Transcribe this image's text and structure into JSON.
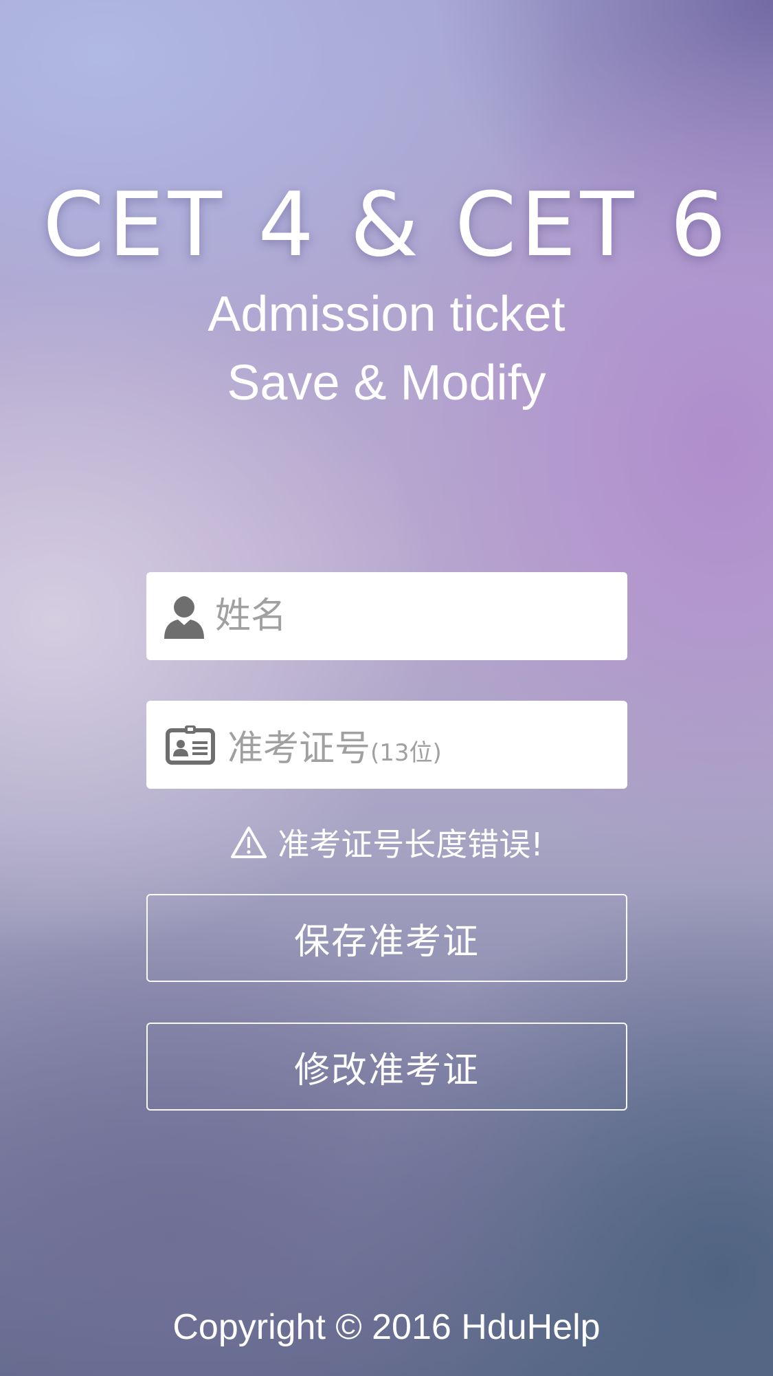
{
  "header": {
    "title": "CET 4  &  CET 6",
    "subtitle_line1": "Admission ticket",
    "subtitle_line2": "Save & Modify"
  },
  "form": {
    "name_field": {
      "placeholder": "姓名",
      "value": "",
      "icon": "user-icon"
    },
    "ticket_field": {
      "placeholder_main": "准考证号",
      "placeholder_hint": "(13位)",
      "value": "",
      "icon": "id-card-icon"
    },
    "error_message": "准考证号长度错误!",
    "error_icon": "warning-icon"
  },
  "actions": {
    "save_label": "保存准考证",
    "modify_label": "修改准考证"
  },
  "footer": {
    "copyright": "Copyright © 2016 HduHelp"
  },
  "colors": {
    "text": "#ffffff",
    "field_background": "#ffffff",
    "placeholder": "#a0a0a0",
    "icon": "#6e6e6e"
  }
}
